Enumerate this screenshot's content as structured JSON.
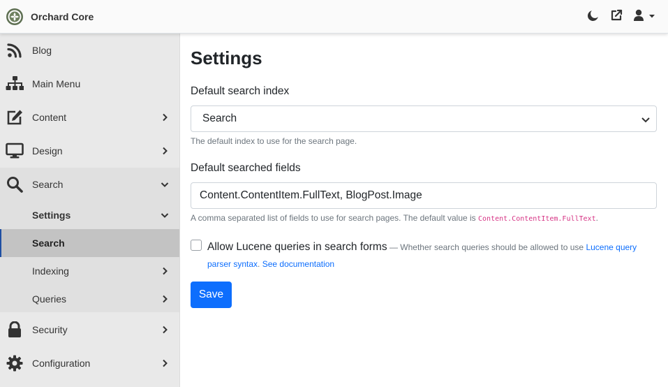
{
  "header": {
    "brand": "Orchard Core",
    "icons": [
      "orchard-core-logo",
      "moon-icon",
      "external-link-icon",
      "user-icon",
      "caret-down-icon"
    ]
  },
  "sidebar": {
    "items": [
      {
        "label": "Blog",
        "icon": "rss-icon"
      },
      {
        "label": "Main Menu",
        "icon": "sitemap-icon"
      },
      {
        "label": "Content",
        "icon": "edit-icon"
      },
      {
        "label": "Design",
        "icon": "desktop-icon"
      },
      {
        "label": "Search",
        "icon": "search-icon"
      },
      {
        "label": "Security",
        "icon": "lock-icon"
      },
      {
        "label": "Configuration",
        "icon": "cog-icon"
      }
    ],
    "search_sub": [
      {
        "label": "Settings"
      },
      {
        "label": "Search"
      },
      {
        "label": "Indexing"
      },
      {
        "label": "Queries"
      }
    ]
  },
  "main": {
    "title": "Settings",
    "index_label": "Default search index",
    "index_selected": "Search",
    "index_hint": "The default index to use for the search page.",
    "fields_label": "Default searched fields",
    "fields_value": "Content.ContentItem.FullText, BlogPost.Image",
    "fields_hint_prefix": "A comma separated list of fields to use for search pages. The default value is ",
    "fields_hint_code": "Content.ContentItem.FullText",
    "fields_hint_suffix": ".",
    "lucene_label": "Allow Lucene queries in search forms",
    "lucene_desc": " — Whether search queries should be allowed to use ",
    "lucene_link1": "Lucene query parser syntax",
    "lucene_sep": ". ",
    "lucene_link2": "See documentation",
    "save_label": "Save"
  },
  "colors": {
    "primary": "#0d6efd",
    "sidebar_bg": "#e9e9e9",
    "sidebar_active": "#c3c3c3",
    "code": "#d63384"
  }
}
